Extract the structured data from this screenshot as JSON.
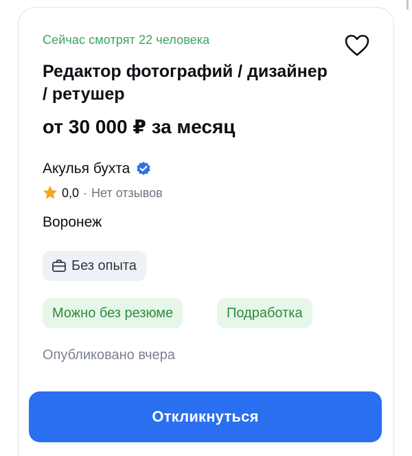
{
  "vacancy": {
    "viewers_text": "Сейчас смотрят 22 человека",
    "title": "Редактор фотографий / дизайнер / ретушер",
    "salary": "от 30 000 ₽ за месяц",
    "company": "Акулья бухта",
    "rating_value": "0,0",
    "rating_separator": "·",
    "reviews_text": "Нет отзывов",
    "city": "Воронеж",
    "experience_chip": "Без опыта",
    "tags": [
      "Можно без резюме",
      "Подработка"
    ],
    "published": "Опубликовано вчера",
    "apply_label": "Откликнуться"
  },
  "icons": {
    "favorite": "heart-outline-icon",
    "verified": "verified-check-icon",
    "rating": "star-icon",
    "experience": "briefcase-icon"
  },
  "colors": {
    "accent_green": "#3aa55c",
    "button_blue": "#2a6ff0",
    "verified_blue": "#2f6fea",
    "star": "#f5a623"
  }
}
